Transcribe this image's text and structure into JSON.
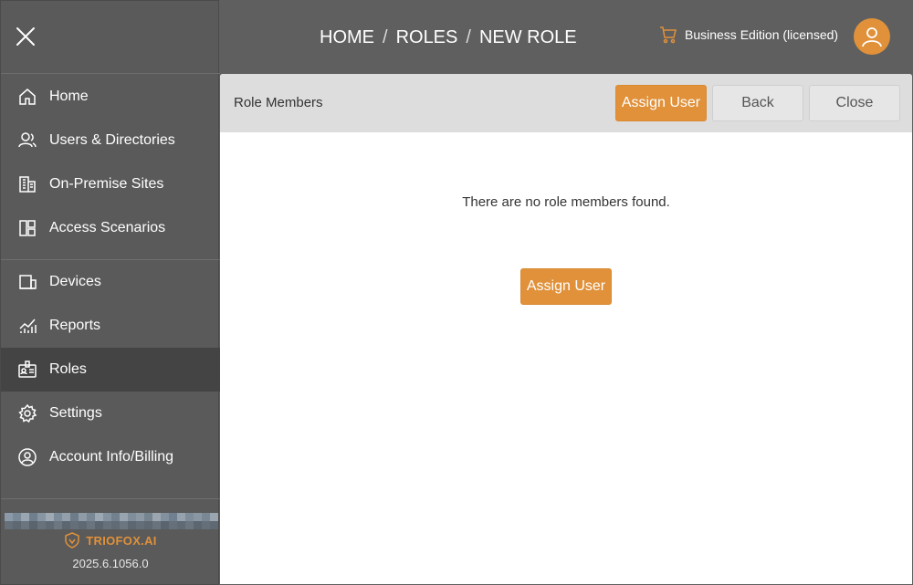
{
  "sidebar": {
    "items": [
      {
        "label": "Home",
        "icon": "home-icon"
      },
      {
        "label": "Users & Directories",
        "icon": "users-icon"
      },
      {
        "label": "On-Premise Sites",
        "icon": "building-icon"
      },
      {
        "label": "Access Scenarios",
        "icon": "layout-icon"
      },
      {
        "label": "Devices",
        "icon": "devices-icon"
      },
      {
        "label": "Reports",
        "icon": "chart-icon"
      },
      {
        "label": "Roles",
        "icon": "id-badge-icon",
        "active": true
      },
      {
        "label": "Settings",
        "icon": "gear-icon"
      },
      {
        "label": "Account Info/Billing",
        "icon": "account-icon"
      }
    ],
    "brand": "TRIOFOX.AI",
    "version": "2025.6.1056.0"
  },
  "header": {
    "breadcrumb": [
      "HOME",
      "ROLES",
      "NEW ROLE"
    ],
    "separator": "/",
    "edition": "Business Edition (licensed)"
  },
  "panel": {
    "title": "Role Members",
    "buttons": {
      "assign": "Assign User",
      "back": "Back",
      "close": "Close"
    },
    "empty_message": "There are no role members found.",
    "center_button": "Assign User"
  },
  "colors": {
    "accent": "#e0913a",
    "sidebar_bg": "#5a5a5a",
    "active_bg": "#444444"
  }
}
